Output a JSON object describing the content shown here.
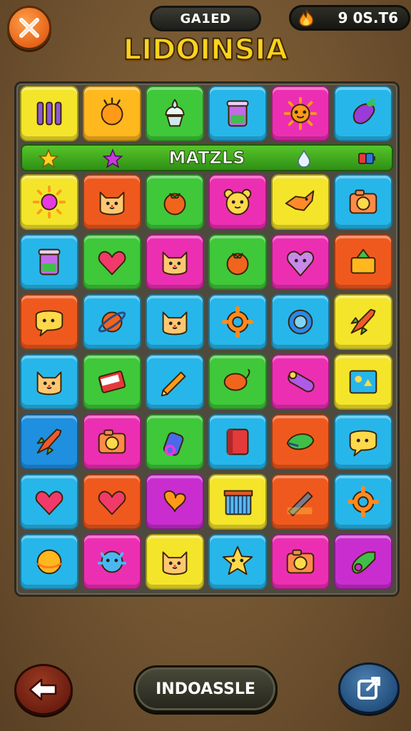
{
  "header": {
    "close_icon": "close-icon",
    "level_label": "GA1ED",
    "score_value": "9 0S.T6",
    "score_icon": "fire-icon",
    "game_title": "LIDOINSIA"
  },
  "banner": {
    "label": "MATZLS",
    "icons": [
      "star-icon",
      "purple-star-icon",
      "droplet-icon",
      "battery-icon"
    ]
  },
  "board": {
    "columns": 6,
    "top_row": [
      {
        "icon": "bars-icon",
        "color": "#f4e52a"
      },
      {
        "icon": "sun-orange-icon",
        "color": "#ffb81e"
      },
      {
        "icon": "ice-cream-icon",
        "color": "#3fc83a"
      },
      {
        "icon": "cup-icon",
        "color": "#27b6ea"
      },
      {
        "icon": "sun-face-icon",
        "color": "#ec2fb2"
      },
      {
        "icon": "eggplant-icon",
        "color": "#27b6ea"
      }
    ],
    "rows": [
      [
        {
          "icon": "sun-icon",
          "color": "#f4e52a"
        },
        {
          "icon": "cat-face-icon",
          "color": "#f0591e"
        },
        {
          "icon": "tomato-icon",
          "color": "#3fc83a"
        },
        {
          "icon": "bear-face-icon",
          "color": "#ec2fb2"
        },
        {
          "icon": "fox-icon",
          "color": "#f4e52a"
        },
        {
          "icon": "camera-icon",
          "color": "#27b6ea"
        }
      ],
      [
        {
          "icon": "cup-icon",
          "color": "#27b6ea"
        },
        {
          "icon": "heart-icon",
          "color": "#3fc83a"
        },
        {
          "icon": "cat-face-icon",
          "color": "#ec2fb2"
        },
        {
          "icon": "tomato-icon",
          "color": "#3fc83a"
        },
        {
          "icon": "heart-face-icon",
          "color": "#ec2fb2"
        },
        {
          "icon": "box-icon",
          "color": "#f0591e"
        }
      ],
      [
        {
          "icon": "speech-bubble-icon",
          "color": "#f0591e"
        },
        {
          "icon": "planet-icon",
          "color": "#27b6ea"
        },
        {
          "icon": "cat-face-icon",
          "color": "#27b6ea"
        },
        {
          "icon": "gear-icon",
          "color": "#27b6ea"
        },
        {
          "icon": "ring-icon",
          "color": "#27b6ea"
        },
        {
          "icon": "rocket-icon",
          "color": "#f4e52a"
        }
      ],
      [
        {
          "icon": "cat-face-icon",
          "color": "#27b6ea"
        },
        {
          "icon": "card-icon",
          "color": "#3fc83a"
        },
        {
          "icon": "pencil-icon",
          "color": "#27b6ea"
        },
        {
          "icon": "balloon-icon",
          "color": "#3fc83a"
        },
        {
          "icon": "tube-icon",
          "color": "#ec2fb2"
        },
        {
          "icon": "picture-icon",
          "color": "#f4e52a"
        }
      ],
      [
        {
          "icon": "rocket-icon",
          "color": "#1f8fe0"
        },
        {
          "icon": "camera-icon",
          "color": "#ec2fb2"
        },
        {
          "icon": "bottle-icon",
          "color": "#3fc83a"
        },
        {
          "icon": "notebook-icon",
          "color": "#27b6ea"
        },
        {
          "icon": "leaf-icon",
          "color": "#f0591e"
        },
        {
          "icon": "speech-bubble-icon",
          "color": "#27b6ea"
        }
      ],
      [
        {
          "icon": "heart-icon",
          "color": "#27b6ea"
        },
        {
          "icon": "heart-icon",
          "color": "#f0591e"
        },
        {
          "icon": "tag-icon",
          "color": "#c92dcf"
        },
        {
          "icon": "cage-icon",
          "color": "#f4e52a"
        },
        {
          "icon": "pen-icon",
          "color": "#f0591e"
        },
        {
          "icon": "gear-icon",
          "color": "#27b6ea"
        }
      ],
      [
        {
          "icon": "ball-icon",
          "color": "#27b6ea"
        },
        {
          "icon": "monster-icon",
          "color": "#ec2fb2"
        },
        {
          "icon": "cat-face-icon",
          "color": "#f4e52a"
        },
        {
          "icon": "star-face-icon",
          "color": "#27b6ea"
        },
        {
          "icon": "camera-icon",
          "color": "#ec2fb2"
        },
        {
          "icon": "whistle-icon",
          "color": "#c92dcf"
        }
      ]
    ]
  },
  "footer": {
    "back_icon": "back-arrow-icon",
    "main_button_label": "INDOASSLE",
    "share_icon": "share-icon"
  }
}
